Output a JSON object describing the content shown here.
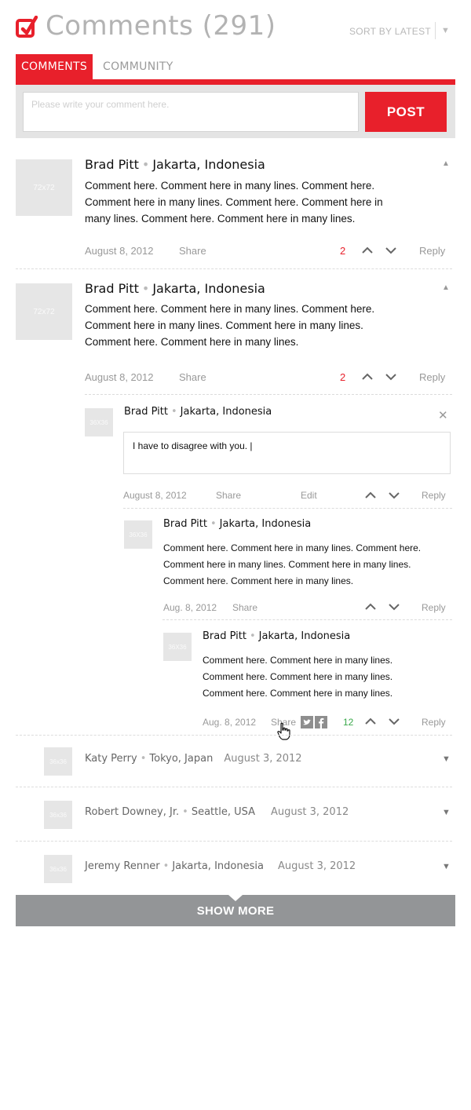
{
  "header": {
    "title": "Comments (291)",
    "sort_label": "SORT BY LATEST"
  },
  "tabs": [
    {
      "label": "COMMENTS",
      "active": true
    },
    {
      "label": "COMMUNITY",
      "active": false
    }
  ],
  "composer": {
    "placeholder": "Please write your comment here.",
    "post_label": "POST"
  },
  "comments": [
    {
      "avatar": "72x72",
      "name": "Brad Pitt",
      "location": "Jakarta, Indonesia",
      "body": "Comment here. Comment here in many lines. Comment here. Comment here in many lines. Comment here. Comment here in many lines. Comment here. Comment here in many lines.",
      "date": "August 8, 2012",
      "share": "Share",
      "votes": "2",
      "reply": "Reply"
    },
    {
      "avatar": "72x72",
      "name": "Brad Pitt",
      "location": "Jakarta, Indonesia",
      "body": "Comment here. Comment here in many lines. Comment here. Comment here in many lines. Comment here in many lines. Comment here. Comment here in many lines.",
      "date": "August 8, 2012",
      "share": "Share",
      "votes": "2",
      "reply": "Reply"
    }
  ],
  "reply_edit": {
    "avatar": "36X36",
    "name": "Brad Pitt",
    "location": "Jakarta, Indonesia",
    "text": "I have to disagree with you. |",
    "date": "August 8, 2012",
    "share": "Share",
    "edit": "Edit",
    "reply": "Reply"
  },
  "nested_1": {
    "avatar": "36X36",
    "name": "Brad Pitt",
    "location": "Jakarta, Indonesia",
    "body": "Comment here. Comment here in many lines. Comment here. Comment here in many lines. Comment here in many lines. Comment here. Comment here in many lines.",
    "date": "Aug. 8, 2012",
    "share": "Share",
    "reply": "Reply"
  },
  "nested_2": {
    "avatar": "36X36",
    "name": "Brad Pitt",
    "location": "Jakarta, Indonesia",
    "body": "Comment here. Comment here in many lines. Comment here. Comment here in many lines. Comment here. Comment here in many lines.",
    "date": "Aug. 8, 2012",
    "share": "Share",
    "votes": "12",
    "reply": "Reply"
  },
  "collapsed": [
    {
      "avatar": "36x36",
      "name": "Katy Perry",
      "location": "Tokyo, Japan",
      "date": "August 3, 2012"
    },
    {
      "avatar": "36x36",
      "name": "Robert Downey, Jr.",
      "location": "Seattle, USA",
      "date": "August 3, 2012"
    },
    {
      "avatar": "36x36",
      "name": "Jeremy Renner",
      "location": "Jakarta, Indonesia",
      "date": "August 3, 2012"
    }
  ],
  "show_more": "SHOW MORE",
  "colors": {
    "accent": "#e8202b",
    "button_gray": "#939597",
    "vote_positive": "#39a84a"
  },
  "icons": [
    "logo-icon",
    "caret-down-icon",
    "caret-up-icon",
    "chevron-up-icon",
    "chevron-down-icon",
    "close-icon",
    "twitter-icon",
    "facebook-icon",
    "hand-cursor-icon"
  ]
}
